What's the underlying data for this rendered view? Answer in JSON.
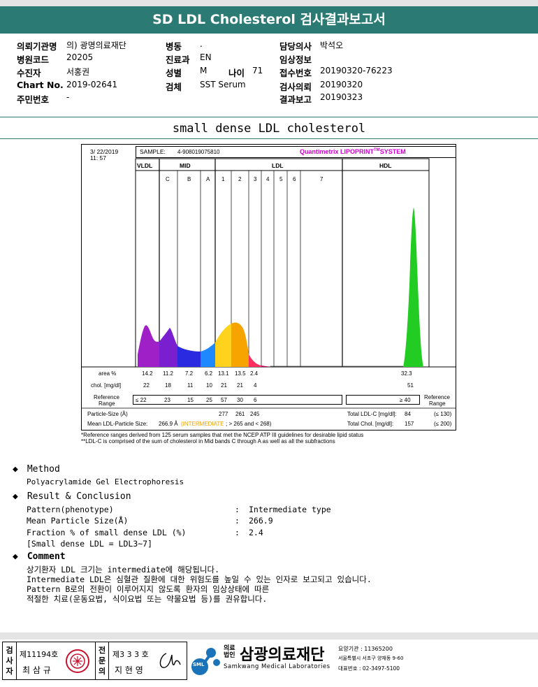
{
  "header": {
    "title": "SD LDL Cholesterol 검사결과보고서"
  },
  "patient": {
    "institution_label": "의뢰기관명",
    "institution": "의) 광명의료재단",
    "hospital_code_label": "병원코드",
    "hospital_code": "20205",
    "patient_label": "수진자",
    "patient_name": "서홍권",
    "chart_label": "Chart No.",
    "chart_no": "2019-02641",
    "rrn_label": "주민번호",
    "rrn": "-",
    "ward_label": "병동",
    "ward": ".",
    "dept_label": "진료과",
    "dept": "EN",
    "sex_label": "성별",
    "sex": "M",
    "age_label": "나이",
    "age": "71",
    "specimen_label": "검체",
    "specimen": "SST Serum",
    "doctor_label": "담당의사",
    "doctor": "박석오",
    "clinical_label": "임상정보",
    "clinical": "",
    "receipt_label": "접수번호",
    "receipt_no": "20190320-76223",
    "request_label": "검사의뢰",
    "request_date": "20190320",
    "report_label": "결과보고",
    "report_date": "20190323"
  },
  "section_title": "small dense LDL cholesterol",
  "lipoprint": {
    "date": "3/ 22/2019",
    "time": "11: 57",
    "sample_label": "SAMPLE:",
    "sample_no": "4-908019075810",
    "brand": "Quantimetrix LIPOPRINT",
    "brand_tm": "TM",
    "brand_system": "SYSTEM",
    "groups": [
      "VLDL",
      "MID",
      "LDL",
      "HDL"
    ],
    "bands": [
      "C",
      "B",
      "A",
      "1",
      "2",
      "3",
      "4",
      "5",
      "6",
      "7"
    ],
    "area_label": "area %",
    "area_values": [
      "14.2",
      "11.2",
      "7.2",
      "6.2",
      "13.1",
      "13.5",
      "2.4"
    ],
    "area_hdl": "32.3",
    "chol_label": "chol. [mg/dl]",
    "chol_values": [
      "22",
      "18",
      "11",
      "10",
      "21",
      "21",
      "4"
    ],
    "chol_hdl": "51",
    "ref_label_1": "Reference",
    "ref_label_2": "Range",
    "ref_values": [
      "≤ 22",
      "23",
      "15",
      "25",
      "57",
      "30",
      "6"
    ],
    "ref_hdl": "≥ 40",
    "particle_size_label": "Particle-Size (Å)",
    "particle_sizes": [
      "277",
      "261",
      "245"
    ],
    "mean_size_label": "Mean LDL-Particle Size:",
    "mean_size_value": "266.9 Å",
    "mean_size_class": "(INTERMEDIATE",
    "mean_size_range": "; > 265 and < 268)",
    "total_ldl_label": "Total LDL-C [mg/dl]:",
    "total_ldl": "84",
    "total_ldl_ref": "(≤ 130)",
    "total_chol_label": "Total Chol. [mg/dl]:",
    "total_chol": "157",
    "total_chol_ref": "(≤ 200)",
    "note_1": "*Reference ranges derived from 125 serum samples that met the NCEP ATP III guidelines for desirable lipid status",
    "note_2": "**LDL-C is comprised of the sum of cholesterol in Mid bands C through A as well as all the subfractions",
    "colors": {
      "vldl": "#a020c8",
      "c": "#7a1fcf",
      "b": "#2a2ae0",
      "a": "#1e88ff",
      "ldl1": "#ffd21e",
      "ldl2": "#f7a400",
      "ldl3": "#ff3060",
      "ldl4": "#c0005a",
      "hdl": "#22cc22",
      "brand": "#cc00cc"
    }
  },
  "method": {
    "heading": "Method",
    "text": "Polyacrylamide Gel Electrophoresis"
  },
  "result": {
    "heading": "Result & Conclusion",
    "rows": [
      {
        "label": "Pattern(phenotype)",
        "sep": ":",
        "value": "Intermediate type"
      },
      {
        "label": "Mean Particle Size(Å)",
        "sep": ":",
        "value": "266.9"
      },
      {
        "label": "Fraction % of small dense LDL (%)",
        "sep": ":",
        "value": "2.4"
      }
    ],
    "note": "[Small dense LDL = LDL3~7]"
  },
  "comment": {
    "heading": "Comment",
    "lines": [
      "상기환자 LDL 크기는 intermediate에 해당됩니다.",
      "Intermediate LDL은 심혈관 질환에 대한 위험도를 높일 수 있는 인자로 보고되고 있습니다.",
      "Pattern B로의 전환이 이루어지지 않도록 환자의 임상상태에 따른",
      "적절한 치료(운동요법, 식이요법 또는 약물요법 등)를 권유합니다."
    ]
  },
  "footer": {
    "inspector_vertical": [
      "검",
      "사",
      "자"
    ],
    "inspector_license": "제11194호",
    "inspector_name": "최 삼 규",
    "specialist_vertical": [
      "전",
      "문",
      "의"
    ],
    "specialist_license": "제3 3 3 호",
    "specialist_name": "지 현 영",
    "logo_small": "SML",
    "org_type_1": "의료",
    "org_type_2": "법인",
    "org_name": "삼광의료재단",
    "org_name_en": "Samkwang Medical Laboratories",
    "care_no": "요양기관 : 11365200",
    "address": "서울특별시 서초구 양재동 9-60",
    "phone": "대표번호 : 02-3497-5100"
  }
}
